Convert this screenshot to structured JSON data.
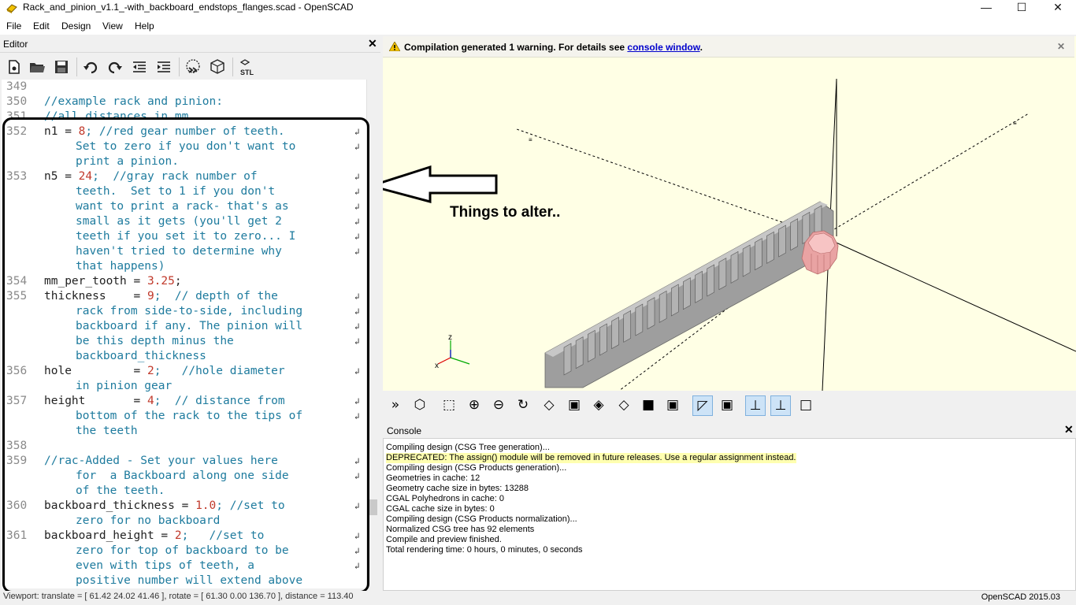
{
  "window": {
    "title": "Rack_and_pinion_v1.1_-with_backboard_endstops_flanges.scad - OpenSCAD",
    "minimize_icon": "minimize-icon",
    "maximize_icon": "maximize-icon",
    "close_icon": "close-icon"
  },
  "menu": [
    "File",
    "Edit",
    "Design",
    "View",
    "Help"
  ],
  "editor": {
    "title": "Editor",
    "toolbar_icons": [
      "new-file-icon",
      "open-file-icon",
      "save-icon",
      "undo-icon",
      "redo-icon",
      "unindent-icon",
      "indent-icon",
      "preview-icon",
      "render-icon",
      "export-stl-icon"
    ],
    "stl_label": "STL",
    "lines": [
      {
        "n": "349",
        "parts": []
      },
      {
        "n": "350",
        "parts": [
          {
            "t": "//example rack and pinion:",
            "c": "cmt"
          }
        ]
      },
      {
        "n": "351",
        "parts": [
          {
            "t": "//all distances in mm",
            "c": "cmt"
          }
        ]
      },
      {
        "n": "352",
        "parts": [
          {
            "t": "n1 = ",
            "c": ""
          },
          {
            "t": "8",
            "c": "num"
          },
          {
            "t": "; //red gear number of teeth.",
            "c": "cmt"
          }
        ]
      },
      {
        "n": "",
        "cont": "Set to zero if you don't want to"
      },
      {
        "n": "",
        "cont": "print a pinion."
      },
      {
        "n": "353",
        "parts": [
          {
            "t": "n5 = ",
            "c": ""
          },
          {
            "t": "24",
            "c": "num"
          },
          {
            "t": ";  //gray rack number of",
            "c": "cmt"
          }
        ]
      },
      {
        "n": "",
        "cont": "teeth.  Set to 1 if you don't"
      },
      {
        "n": "",
        "cont": "want to print a rack- that's as"
      },
      {
        "n": "",
        "cont": "small as it gets (you'll get 2"
      },
      {
        "n": "",
        "cont": "teeth if you set it to zero... I"
      },
      {
        "n": "",
        "cont": "haven't tried to determine why"
      },
      {
        "n": "",
        "cont": "that happens)"
      },
      {
        "n": "354",
        "parts": [
          {
            "t": "mm_per_tooth = ",
            "c": ""
          },
          {
            "t": "3.25",
            "c": "num"
          },
          {
            "t": ";",
            "c": ""
          }
        ]
      },
      {
        "n": "355",
        "parts": [
          {
            "t": "thickness    = ",
            "c": ""
          },
          {
            "t": "9",
            "c": "num"
          },
          {
            "t": ";  // depth of the",
            "c": "cmt"
          }
        ]
      },
      {
        "n": "",
        "cont": "rack from side-to-side, including"
      },
      {
        "n": "",
        "cont": "backboard if any. The pinion will"
      },
      {
        "n": "",
        "cont": "be this depth minus the"
      },
      {
        "n": "",
        "cont": "backboard_thickness"
      },
      {
        "n": "356",
        "parts": [
          {
            "t": "hole         = ",
            "c": ""
          },
          {
            "t": "2",
            "c": "num"
          },
          {
            "t": ";   //hole diameter",
            "c": "cmt"
          }
        ]
      },
      {
        "n": "",
        "cont": "in pinion gear"
      },
      {
        "n": "357",
        "parts": [
          {
            "t": "height       = ",
            "c": ""
          },
          {
            "t": "4",
            "c": "num"
          },
          {
            "t": ";  // distance from",
            "c": "cmt"
          }
        ]
      },
      {
        "n": "",
        "cont": "bottom of the rack to the tips of"
      },
      {
        "n": "",
        "cont": "the teeth"
      },
      {
        "n": "358",
        "parts": []
      },
      {
        "n": "359",
        "parts": [
          {
            "t": "//rac-Added - Set your values here",
            "c": "cmt"
          }
        ]
      },
      {
        "n": "",
        "cont": "for  a Backboard along one side"
      },
      {
        "n": "",
        "cont": "of the teeth."
      },
      {
        "n": "360",
        "parts": [
          {
            "t": "backboard_thickness = ",
            "c": ""
          },
          {
            "t": "1.0",
            "c": "num"
          },
          {
            "t": "; //set to",
            "c": "cmt"
          }
        ]
      },
      {
        "n": "",
        "cont": "zero for no backboard"
      },
      {
        "n": "361",
        "parts": [
          {
            "t": "backboard_height = ",
            "c": ""
          },
          {
            "t": "2",
            "c": "num"
          },
          {
            "t": ";   //set to",
            "c": "cmt"
          }
        ]
      },
      {
        "n": "",
        "cont": "zero for top of backboard to be"
      },
      {
        "n": "",
        "cont": "even with tips of teeth, a"
      },
      {
        "n": "",
        "cont": "positive number will extend above"
      }
    ]
  },
  "viewport": {
    "warning_prefix": "Compilation generated 1 warning. For details see ",
    "warning_link": "console window",
    "warning_suffix": ".",
    "annotation": "Things to alter..",
    "axis_labels": {
      "z": "z",
      "x": "x"
    },
    "rack_color": "#a6a6a6",
    "pinion_color": "#f3b7b7",
    "background": "#ffffe5"
  },
  "view_toolbar_icons": [
    "preview-icon",
    "render-icon",
    "view-all-icon",
    "zoom-in-icon",
    "zoom-out-icon",
    "reset-view-icon",
    "view-right-icon",
    "view-top-icon",
    "view-bottom-icon",
    "view-left-icon",
    "view-front-icon",
    "view-back-icon",
    "perspective-icon",
    "orthogonal-icon",
    "show-axes-icon",
    "show-scale-markers-icon",
    "show-edges-icon"
  ],
  "console": {
    "title": "Console",
    "lines": [
      {
        "text": "Compiling design (CSG Tree generation)...",
        "warn": false
      },
      {
        "text": "DEPRECATED: The assign() module will be removed in future releases. Use a regular assignment instead.",
        "warn": true
      },
      {
        "text": "Compiling design (CSG Products generation)...",
        "warn": false
      },
      {
        "text": "Geometries in cache: 12",
        "warn": false
      },
      {
        "text": "Geometry cache size in bytes: 13288",
        "warn": false
      },
      {
        "text": "CGAL Polyhedrons in cache: 0",
        "warn": false
      },
      {
        "text": "CGAL cache size in bytes: 0",
        "warn": false
      },
      {
        "text": "Compiling design (CSG Products normalization)...",
        "warn": false
      },
      {
        "text": "Normalized CSG tree has 92 elements",
        "warn": false
      },
      {
        "text": "Compile and preview finished.",
        "warn": false
      },
      {
        "text": "Total rendering time: 0 hours, 0 minutes, 0 seconds",
        "warn": false
      }
    ]
  },
  "status": {
    "viewport_info": "Viewport: translate = [ 61.42 24.02 41.46 ], rotate = [ 61.30 0.00 136.70 ], distance = 113.40",
    "version": "OpenSCAD 2015.03"
  }
}
